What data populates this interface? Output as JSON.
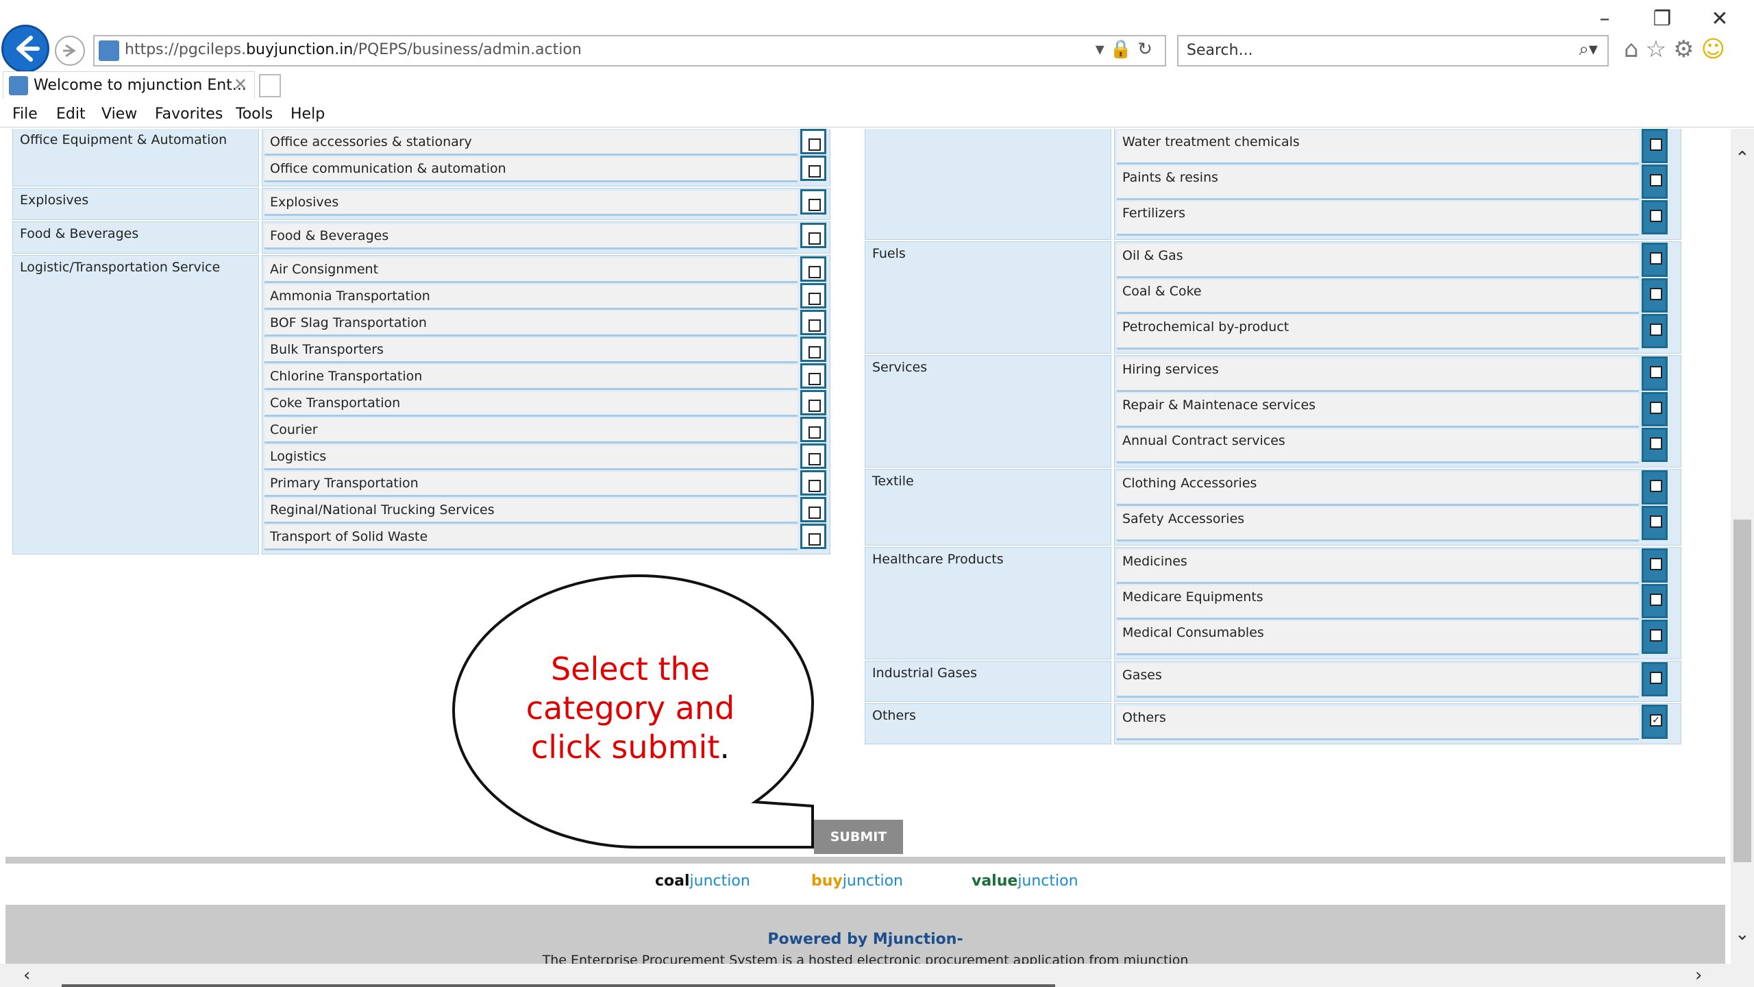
{
  "browser": {
    "url_prefix": "https://pgcileps.",
    "url_domain": "buyjunction.in",
    "url_path": "/PQEPS/business/admin.action",
    "search_placeholder": "Search...",
    "tab_title": "Welcome to mjunction Ent...",
    "tab_close": "✕",
    "window": {
      "minimize": "–",
      "restore": "❐",
      "close": "✕"
    }
  },
  "menu": [
    "File",
    "Edit",
    "View",
    "Favorites",
    "Tools",
    "Help"
  ],
  "left_categories": [
    {
      "label": "Office Equipment & Automation",
      "items": [
        "Office accessories & stationary",
        "Office communication & automation"
      ]
    },
    {
      "label": "Explosives",
      "items": [
        "Explosives"
      ]
    },
    {
      "label": "Food & Beverages",
      "items": [
        "Food & Beverages"
      ]
    },
    {
      "label": "Logistic/Transportation Service",
      "items": [
        "Air Consignment",
        "Ammonia Transportation",
        "BOF Slag Transportation",
        "Bulk Transporters",
        "Chlorine Transportation",
        "Coke Transportation",
        "Courier",
        "Logistics",
        "Primary Transportation",
        "Reginal/National Trucking Services",
        "Transport of Solid Waste"
      ]
    }
  ],
  "right_categories": [
    {
      "label": "",
      "items": [
        "Water treatment chemicals",
        "Paints & resins",
        "Fertilizers"
      ]
    },
    {
      "label": "Fuels",
      "items": [
        "Oil & Gas",
        "Coal & Coke",
        "Petrochemical by-product"
      ]
    },
    {
      "label": "Services",
      "items": [
        "Hiring services",
        "Repair & Maintenace services",
        "Annual Contract services"
      ]
    },
    {
      "label": "Textile",
      "items": [
        "Clothing Accessories",
        "Safety Accessories"
      ]
    },
    {
      "label": "Healthcare Products",
      "items": [
        "Medicines",
        "Medicare Equipments",
        "Medical Consumables"
      ]
    },
    {
      "label": "Industrial Gases",
      "items": [
        "Gases"
      ]
    },
    {
      "label": "Others",
      "items": [
        "Others"
      ],
      "checked": [
        true
      ]
    }
  ],
  "callout": {
    "line1": "Select the",
    "line2": "category and",
    "line3": "click submit",
    "dot": "."
  },
  "submit_label": "SUBMIT",
  "footer": {
    "logo_coal_a": "coal",
    "logo_coal_b": "junction",
    "logo_buy_a": "buy",
    "logo_buy_b": "junction",
    "logo_value_a": "value",
    "logo_value_b": "junction",
    "powered": "Powered by Mjunction-",
    "tagline": "The Enterprise Procurement System is a hosted electronic procurement application from mjunction"
  }
}
